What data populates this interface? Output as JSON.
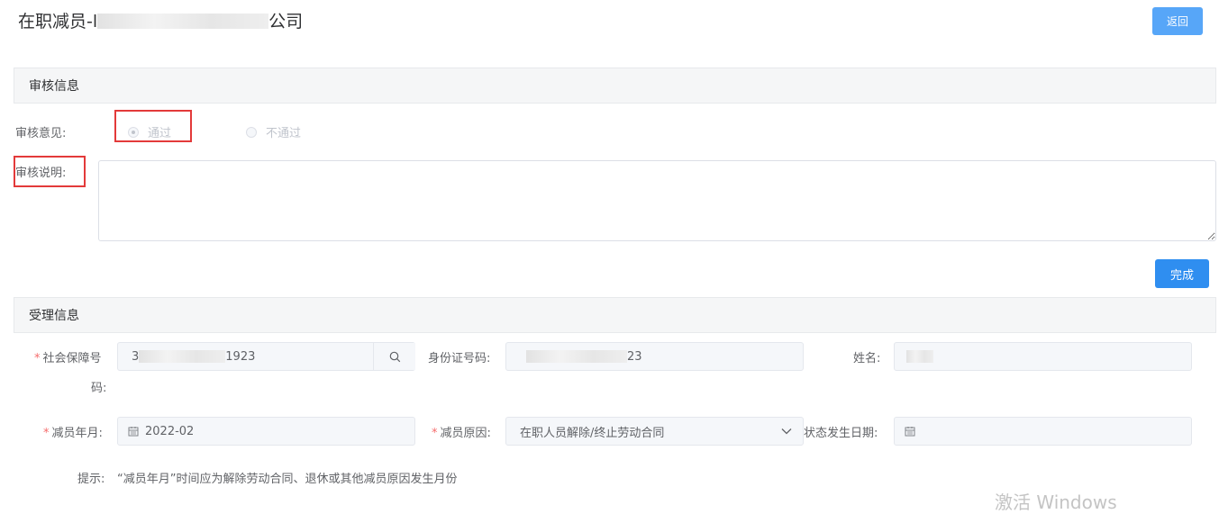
{
  "header": {
    "title_prefix": "在职减员-l",
    "title_suffix": "公司",
    "back_label": "返回"
  },
  "review": {
    "section_title": "审核信息",
    "opinion_label": "审核意见:",
    "option_pass": "通过",
    "option_fail": "不通过",
    "selected": "通过",
    "desc_label": "审核说明:",
    "desc_value": "",
    "done_label": "完成"
  },
  "acceptance": {
    "section_title": "受理信息",
    "ss_label_line1": "社会保障号",
    "ss_label_line2": "码:",
    "ss_value_start": "3",
    "ss_value_end": "1923",
    "id_label": "身份证号码:",
    "id_value_end": "23",
    "name_label": "姓名:",
    "month_label": "减员年月:",
    "month_value": "2022-02",
    "reason_label": "减员原因:",
    "reason_value": "在职人员解除/终止劳动合同",
    "status_date_label": "状态发生日期:",
    "status_date_value": "",
    "hint_label": "提示:",
    "hint_text": "“减员年月”时间应为解除劳动合同、退休或其他减员原因发生月份"
  },
  "watermark": "激活 Windows",
  "colors": {
    "primary": "#2f8ef0",
    "back_button": "#57a6f8",
    "highlight_box": "#e33a3a",
    "required": "#f56c6c"
  },
  "icons": [
    "search-icon",
    "calendar-icon",
    "chevron-down-icon"
  ]
}
